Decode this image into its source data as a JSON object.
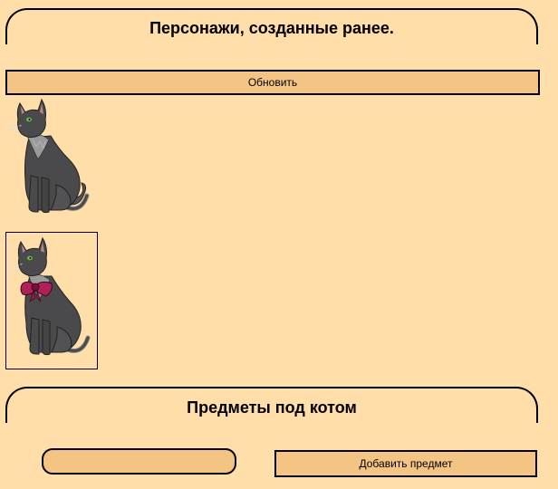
{
  "characters_section": {
    "title": "Персонажи, созданные ранее.",
    "refresh_label": "Обновить",
    "characters": [
      {
        "icon": "gray-cat-sprite",
        "selected": false
      },
      {
        "icon": "gray-cat-with-red-bow-sprite",
        "selected": true
      }
    ]
  },
  "items_section": {
    "title": "Предметы под котом",
    "input_value": "",
    "input_placeholder": "",
    "add_label": "Добавить предмет"
  },
  "colors": {
    "background": "#FFDEAA",
    "button": "#F4C484",
    "border": "#000000",
    "cat_fur": "#4A4A4C",
    "cat_eye": "#6FBF3A",
    "bow": "#B0205A"
  }
}
